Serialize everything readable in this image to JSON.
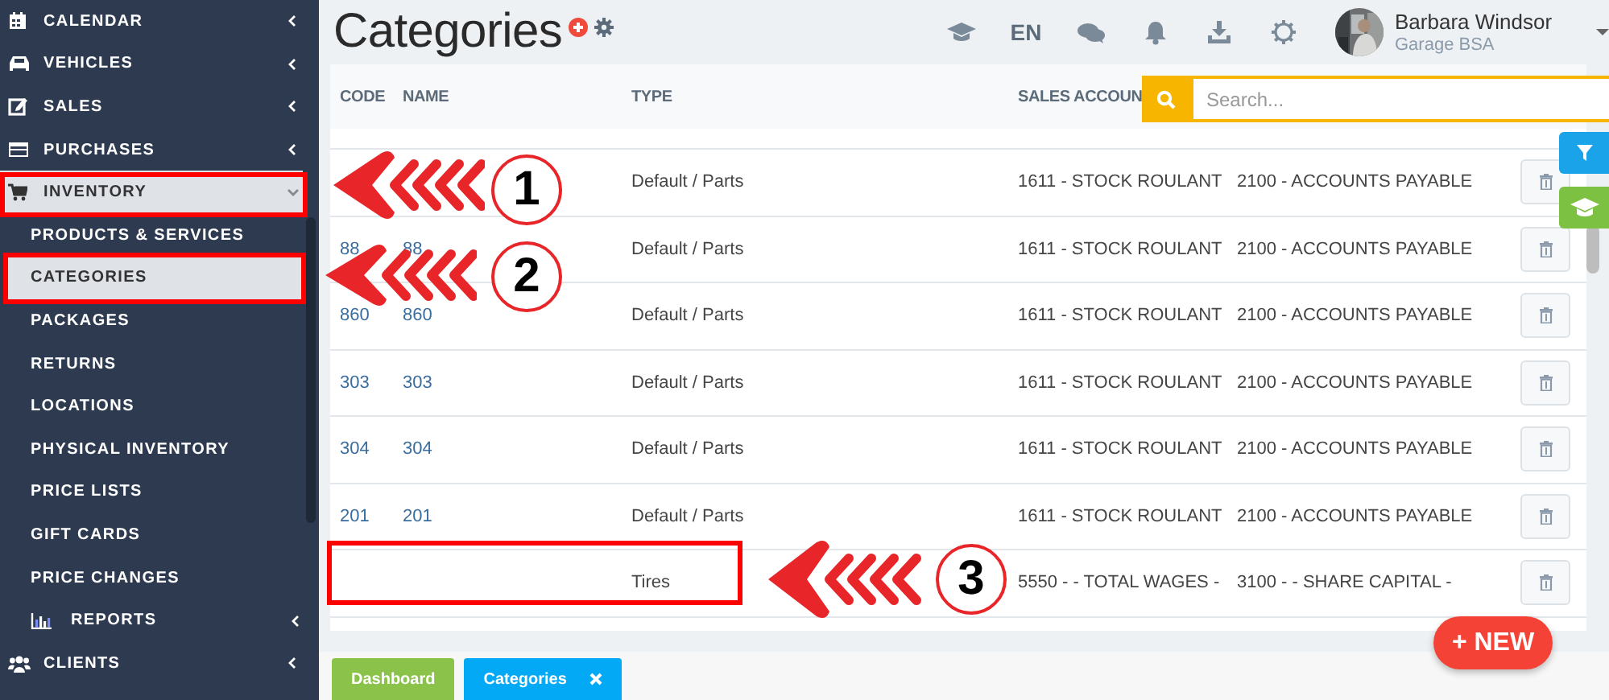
{
  "sidebar": {
    "items": [
      {
        "label": "CALENDAR",
        "expanded": false,
        "selected": false
      },
      {
        "label": "VEHICLES",
        "expanded": false,
        "selected": false
      },
      {
        "label": "SALES",
        "expanded": false,
        "selected": false
      },
      {
        "label": "PURCHASES",
        "expanded": false,
        "selected": false
      },
      {
        "label": "INVENTORY",
        "expanded": true,
        "selected": true,
        "children": [
          {
            "label": "PRODUCTS & SERVICES",
            "selected": false
          },
          {
            "label": "CATEGORIES",
            "selected": true
          },
          {
            "label": "PACKAGES",
            "selected": false
          },
          {
            "label": "RETURNS",
            "selected": false
          },
          {
            "label": "LOCATIONS",
            "selected": false
          },
          {
            "label": "PHYSICAL INVENTORY",
            "selected": false
          },
          {
            "label": "PRICE LISTS",
            "selected": false
          },
          {
            "label": "GIFT CARDS",
            "selected": false
          },
          {
            "label": "PRICE CHANGES",
            "selected": false
          },
          {
            "label": "REPORTS",
            "selected": false,
            "expanded": false
          }
        ]
      },
      {
        "label": "CLIENTS",
        "expanded": false,
        "selected": false
      }
    ]
  },
  "header": {
    "title": "Categories",
    "language": "EN",
    "user": {
      "name": "Barbara Windsor",
      "company": "Garage BSA"
    }
  },
  "search": {
    "placeholder": "Search..."
  },
  "table": {
    "columns": [
      "CODE",
      "NAME",
      "TYPE",
      "SALES ACCOUN"
    ],
    "rows": [
      {
        "type": "Default / Parts",
        "sales_account": "1611 - STOCK ROULANT",
        "column_5": "2100 - ACCOUNTS PAYABLE"
      },
      {
        "code": "88",
        "name": "88",
        "type": "Default / Parts",
        "sales_account": "1611 - STOCK ROULANT",
        "column_5": "2100 - ACCOUNTS PAYABLE"
      },
      {
        "code": "860",
        "name": "860",
        "type": "Default / Parts",
        "sales_account": "1611 - STOCK ROULANT",
        "column_5": "2100 - ACCOUNTS PAYABLE"
      },
      {
        "code": "303",
        "name": "303",
        "type": "Default / Parts",
        "sales_account": "1611 - STOCK ROULANT",
        "column_5": "2100 - ACCOUNTS PAYABLE"
      },
      {
        "code": "304",
        "name": "304",
        "type": "Default / Parts",
        "sales_account": "1611 - STOCK ROULANT",
        "column_5": "2100 - ACCOUNTS PAYABLE"
      },
      {
        "code": "201",
        "name": "201",
        "type": "Default / Parts",
        "sales_account": "1611 - STOCK ROULANT",
        "column_5": "2100 - ACCOUNTS PAYABLE"
      },
      {
        "type": "Tires",
        "sales_account": "5550 - - TOTAL WAGES -",
        "column_5": "3100 - - SHARE CAPITAL -"
      }
    ]
  },
  "new_button": "+ NEW",
  "footer_tabs": [
    {
      "label": "Dashboard",
      "selected": false,
      "closable": false
    },
    {
      "label": "Categories",
      "selected": true,
      "closable": true
    }
  ],
  "annotations": [
    {
      "number": "1"
    },
    {
      "number": "2"
    },
    {
      "number": "3"
    }
  ]
}
